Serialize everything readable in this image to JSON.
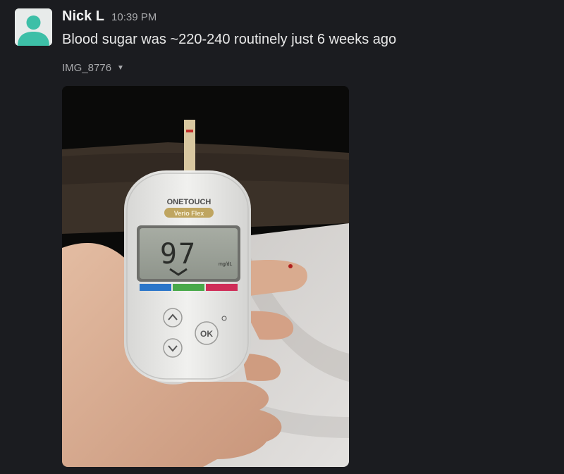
{
  "message": {
    "author": "Nick L",
    "time": "10:39 PM",
    "text": "Blood sugar was ~220-240 routinely just 6 weeks ago",
    "attachment": {
      "name": "IMG_8776",
      "caret_icon": "caret-down-icon"
    }
  },
  "avatar": {
    "icon": "default-user-avatar-icon"
  },
  "photo": {
    "meter_brand": "ONETOUCH",
    "meter_model": "Verio Flex",
    "reading": "97",
    "unit": "mg/dL",
    "ok_label": "OK"
  },
  "colors": {
    "background": "#1b1c20",
    "avatar_teal": "#3dbfa7",
    "text_primary": "#e8e8e8",
    "text_muted": "#a9aaad"
  }
}
